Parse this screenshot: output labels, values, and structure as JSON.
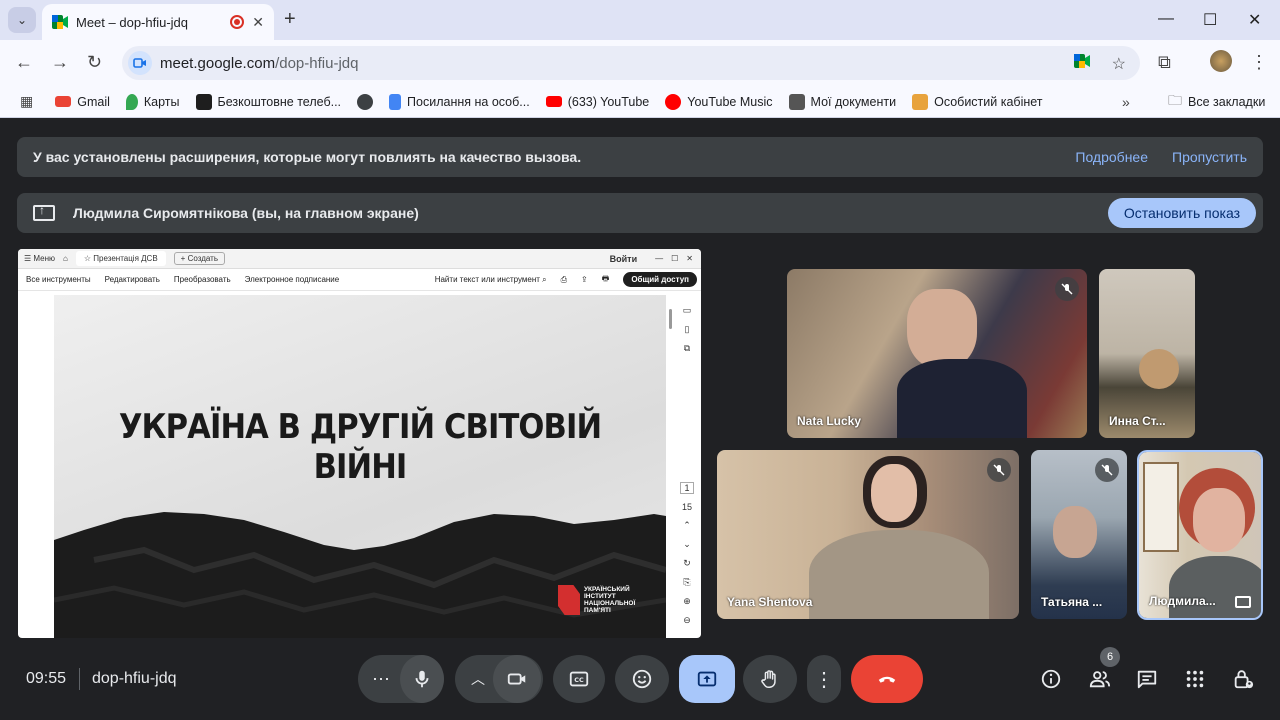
{
  "browser": {
    "tab_title": "Meet – dop-hfiu-jdq",
    "url_host": "meet.google.com",
    "url_path": "/dop-hfiu-jdq",
    "bookmarks": [
      {
        "label": "Gmail",
        "color": "#ea4335"
      },
      {
        "label": "Карты",
        "color": "#34a853"
      },
      {
        "label": "Безкоштовне телеб...",
        "color": "#1e1e1e"
      },
      {
        "label": "",
        "color": "#3c4043"
      },
      {
        "label": "Посилання на особ...",
        "color": "#4285f4"
      },
      {
        "label": "(633) YouTube",
        "color": "#ff0000"
      },
      {
        "label": "YouTube Music",
        "color": "#ff0000"
      },
      {
        "label": "Мої документи",
        "color": "#555555"
      },
      {
        "label": "Особистий кабінет",
        "color": "#e8a33d"
      }
    ],
    "all_bookmarks": "Все закладки"
  },
  "meet": {
    "banner_text": "У вас установлены расширения, которые могут повлиять на качество вызова.",
    "banner_more": "Подробнее",
    "banner_skip": "Пропустить",
    "presenting_text": "Людмила Сиромятнікова (вы, на главном экране)",
    "stop_button": "Остановить показ",
    "clock": "09:55",
    "meeting_code": "dop-hfiu-jdq",
    "participants_count": "6",
    "accent": "#a8c7fa",
    "end_color": "#ea4335"
  },
  "shared_screen": {
    "menu": "Меню",
    "tab": "Презентація ДСВ",
    "create": "Создать",
    "login": "Войти",
    "tools": [
      "Все инструменты",
      "Редактировать",
      "Преобразовать",
      "Электронное подписание"
    ],
    "search": "Найти текст или инструмент",
    "share": "Общий доступ",
    "slide_title": "УКРАЇНА В ДРУГІЙ СВІТОВІЙ ВІЙНІ",
    "logo_text": "УКРАЇНСЬКИЙ ІНСТИТУТ НАЦІОНАЛЬНОЇ ПАМ'ЯТІ",
    "page_current": "1",
    "page_total": "15"
  },
  "participants": [
    {
      "name": "Nata Lucky"
    },
    {
      "name": "Инна Ст..."
    },
    {
      "name": "Yana Shentova"
    },
    {
      "name": "Татьяна ..."
    },
    {
      "name": "Людмила..."
    }
  ]
}
